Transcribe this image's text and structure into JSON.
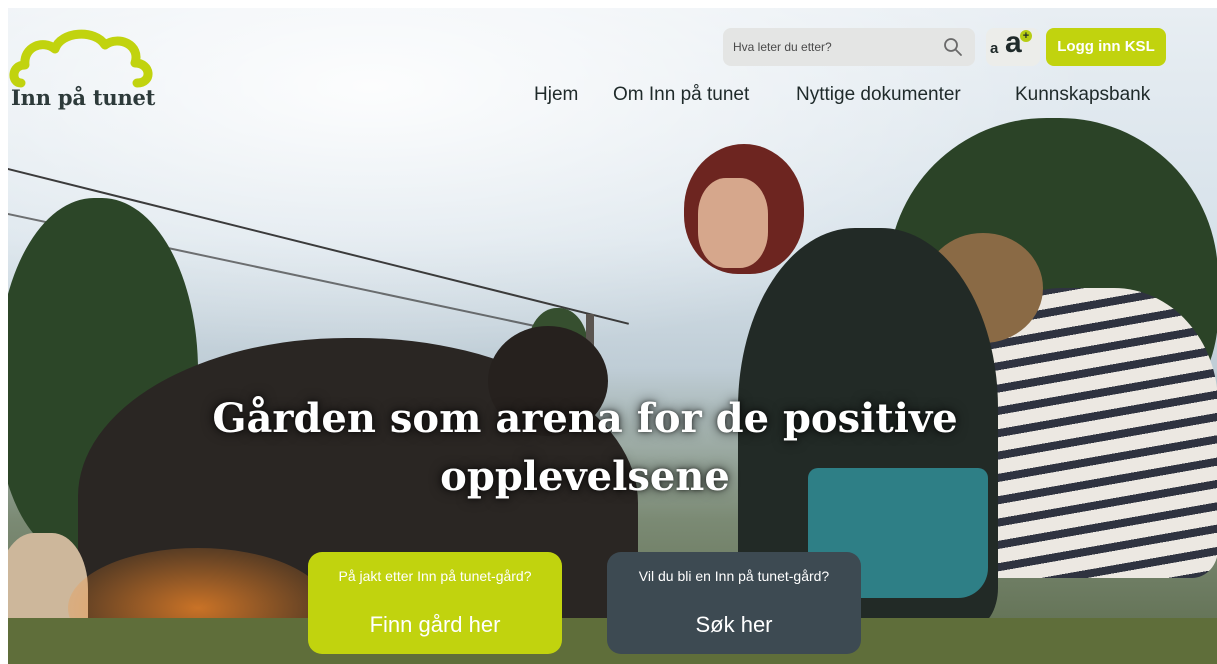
{
  "site": {
    "logo_text": "Inn på tunet",
    "brand_color": "#c1d30e",
    "dark_color": "#3d4a52"
  },
  "header": {
    "search_placeholder": "Hva leter du etter?",
    "search_icon": "search-icon",
    "a11y_small": "a",
    "a11y_large": "a",
    "a11y_plus": "+",
    "login_label": "Logg inn KSL"
  },
  "nav": {
    "items": [
      "Hjem",
      "Om Inn på tunet",
      "Nyttige dokumenter",
      "Kunnskapsbank"
    ]
  },
  "hero": {
    "headline_line1": "Gården som arena for de positive",
    "headline_line2": "opplevelsene",
    "cta_left_small": "På jakt etter Inn på tunet-gård?",
    "cta_left_big": "Finn gård her",
    "cta_right_small": "Vil du bli en Inn på tunet-gård?",
    "cta_right_big": "Søk her"
  }
}
